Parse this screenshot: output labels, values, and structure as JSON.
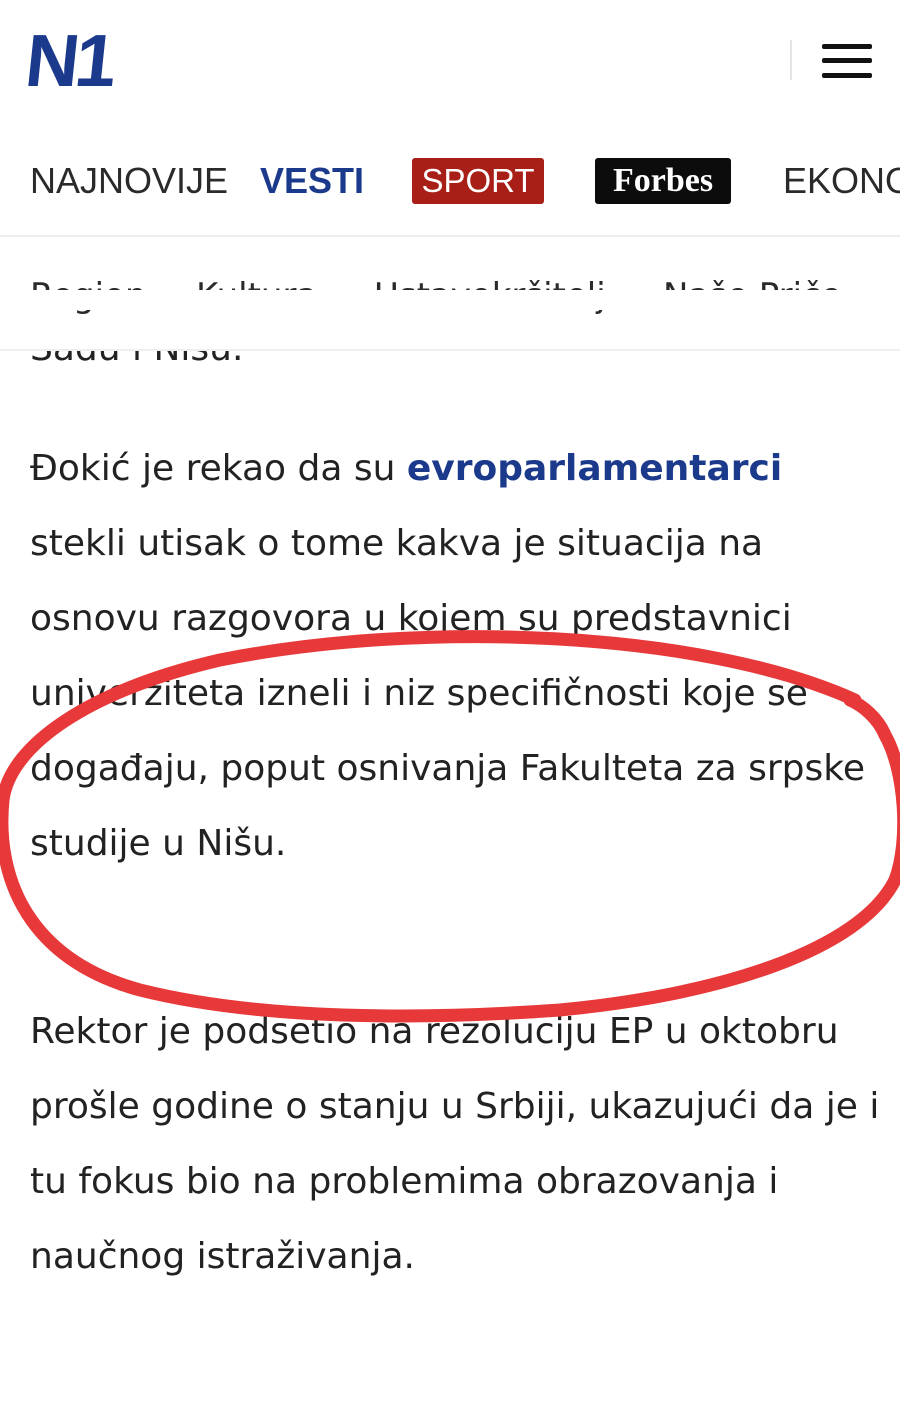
{
  "header": {
    "logo": "N1",
    "menu_icon": "hamburger-icon"
  },
  "nav_primary": {
    "items": [
      {
        "label": "NAJNOVIJE"
      },
      {
        "label": "VESTI"
      },
      {
        "label": "SPORT"
      },
      {
        "label": "Forbes"
      },
      {
        "label": "EKONO"
      }
    ]
  },
  "nav_secondary": {
    "items": [
      {
        "label": "Region"
      },
      {
        "label": "Kultura"
      },
      {
        "label": "Ustavokršitelj"
      },
      {
        "label": "Naše Priče"
      }
    ]
  },
  "article": {
    "partial_line": "Sadu i Nišu.",
    "p1_before": "Đokić je rekao da su ",
    "p1_link": "evroparlamentarci",
    "p1_after": " stekli utisak o tome kakva je situacija na osnovu razgovora u kojem su predstavnici univerziteta izneli i niz specifičnosti koje se događaju, poput osnivanja Fakulteta za srpske studije u Nišu.",
    "p2": "Rektor je podsetio na rezoluciju EP u oktobru prošle godine o stanju u Srbiji, ukazujući da je i tu fokus bio na problemima obrazovanja i naučnog istraživanja."
  },
  "colors": {
    "brand_blue": "#1b3a8c",
    "sport_red": "#a81f17",
    "forbes_black": "#0c0c0c",
    "annotation_red": "#e8393a"
  }
}
